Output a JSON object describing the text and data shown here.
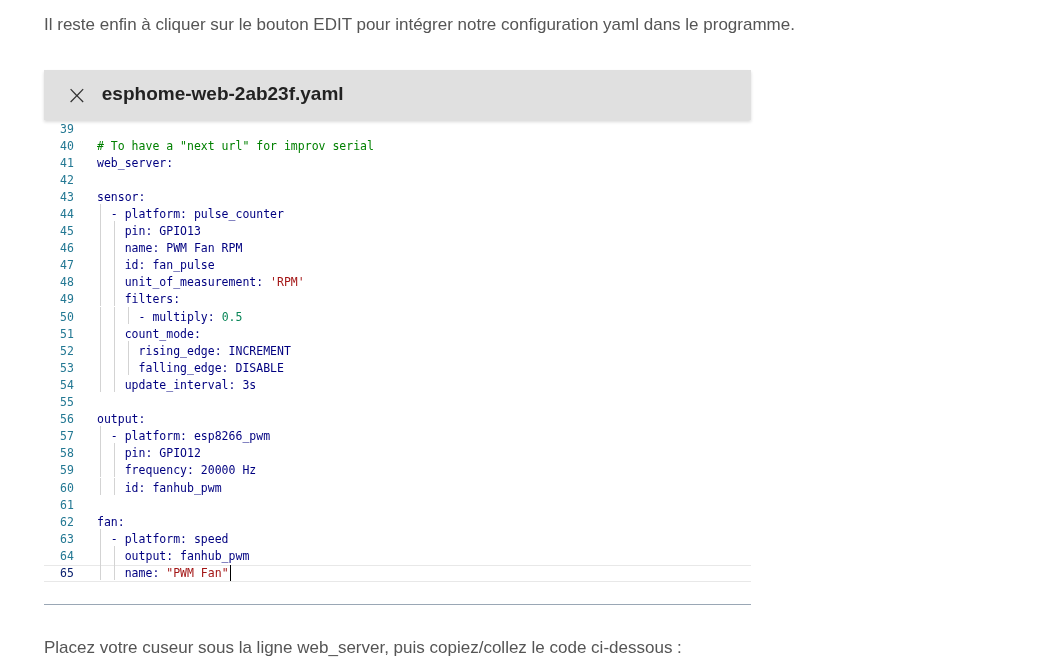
{
  "intro": "Il reste enfin à cliquer sur le bouton EDIT pour intégrer notre configuration yaml dans le programme.",
  "editor": {
    "close_icon": "×",
    "title": "esphome-web-2ab23f.yaml",
    "lines": [
      {
        "number": "39",
        "current": false
      },
      {
        "number": "40",
        "current": false,
        "tokens": [
          {
            "text": "# To have a \"next url\" for improv serial",
            "kind": "comment"
          }
        ]
      },
      {
        "number": "41",
        "current": false,
        "tokens": [
          {
            "text": "web_server:",
            "kind": "key"
          }
        ]
      },
      {
        "number": "42",
        "current": false
      },
      {
        "number": "43",
        "current": false,
        "tokens": [
          {
            "text": "sensor:",
            "kind": "key"
          }
        ]
      },
      {
        "number": "44",
        "current": false,
        "tokens": [
          {
            "text": "  - platform: pulse_counter",
            "kind": "key"
          }
        ]
      },
      {
        "number": "45",
        "current": false,
        "tokens": [
          {
            "text": "    pin: GPIO13",
            "kind": "key"
          }
        ]
      },
      {
        "number": "46",
        "current": false,
        "tokens": [
          {
            "text": "    name: PWM Fan RPM",
            "kind": "key"
          }
        ]
      },
      {
        "number": "47",
        "current": false,
        "tokens": [
          {
            "text": "    id: fan_pulse",
            "kind": "key"
          }
        ]
      },
      {
        "number": "48",
        "current": false,
        "tokens": [
          {
            "text": "    unit_of_measurement: ",
            "kind": "key"
          },
          {
            "text": "'RPM'",
            "kind": "string"
          }
        ]
      },
      {
        "number": "49",
        "current": false,
        "tokens": [
          {
            "text": "    filters:",
            "kind": "key"
          }
        ]
      },
      {
        "number": "50",
        "current": false,
        "tokens": [
          {
            "text": "      - multiply: ",
            "kind": "key"
          },
          {
            "text": "0.5",
            "kind": "number"
          }
        ]
      },
      {
        "number": "51",
        "current": false,
        "tokens": [
          {
            "text": "    count_mode:",
            "kind": "key"
          }
        ]
      },
      {
        "number": "52",
        "current": false,
        "tokens": [
          {
            "text": "      rising_edge: INCREMENT",
            "kind": "key"
          }
        ]
      },
      {
        "number": "53",
        "current": false,
        "tokens": [
          {
            "text": "      falling_edge: DISABLE",
            "kind": "key"
          }
        ]
      },
      {
        "number": "54",
        "current": false,
        "tokens": [
          {
            "text": "    update_interval: 3s",
            "kind": "key"
          }
        ]
      },
      {
        "number": "55",
        "current": false
      },
      {
        "number": "56",
        "current": false,
        "tokens": [
          {
            "text": "output:",
            "kind": "key"
          }
        ]
      },
      {
        "number": "57",
        "current": false,
        "tokens": [
          {
            "text": "  - platform: esp8266_pwm",
            "kind": "key"
          }
        ]
      },
      {
        "number": "58",
        "current": false,
        "tokens": [
          {
            "text": "    pin: GPIO12",
            "kind": "key"
          }
        ]
      },
      {
        "number": "59",
        "current": false,
        "tokens": [
          {
            "text": "    frequency: 20000 Hz",
            "kind": "key"
          }
        ]
      },
      {
        "number": "60",
        "current": false,
        "tokens": [
          {
            "text": "    id: fanhub_pwm",
            "kind": "key"
          }
        ]
      },
      {
        "number": "61",
        "current": false
      },
      {
        "number": "62",
        "current": false,
        "tokens": [
          {
            "text": "fan:",
            "kind": "key"
          }
        ]
      },
      {
        "number": "63",
        "current": false,
        "tokens": [
          {
            "text": "  - platform: speed",
            "kind": "key"
          }
        ]
      },
      {
        "number": "64",
        "current": false,
        "tokens": [
          {
            "text": "    output: fanhub_pwm",
            "kind": "key"
          }
        ]
      },
      {
        "number": "65",
        "current": true,
        "tokens": [
          {
            "text": "    name: ",
            "kind": "key"
          },
          {
            "text": "\"PWM Fan\"",
            "kind": "string"
          }
        ]
      }
    ]
  },
  "outro": "Placez votre cuseur sous la ligne web_server, puis copiez/collez le code ci-dessous :"
}
